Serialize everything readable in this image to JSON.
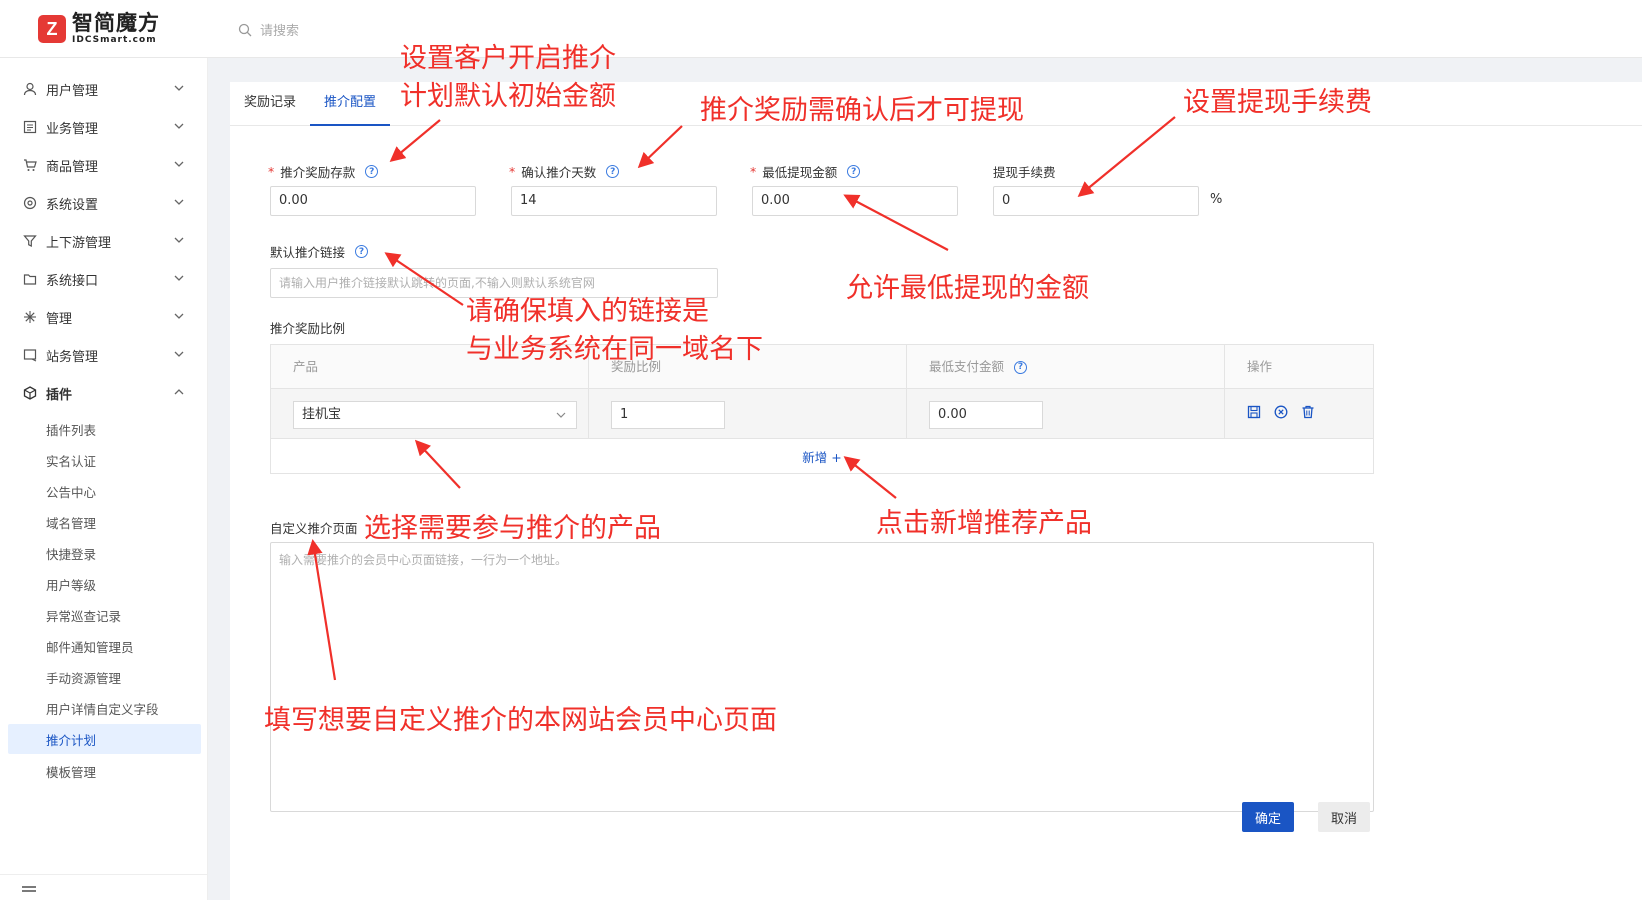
{
  "header": {
    "logo_cn": "智简魔方",
    "logo_en": "IDCSmart.com",
    "search_placeholder": "请搜索"
  },
  "sidebar": {
    "items": [
      {
        "label": "用户管理",
        "icon": "user-icon"
      },
      {
        "label": "业务管理",
        "icon": "list-icon"
      },
      {
        "label": "商品管理",
        "icon": "cart-icon"
      },
      {
        "label": "系统设置",
        "icon": "settings-icon"
      },
      {
        "label": "上下游管理",
        "icon": "filter-icon"
      },
      {
        "label": "系统接口",
        "icon": "folder-icon"
      },
      {
        "label": "管理",
        "icon": "asterisk-icon"
      },
      {
        "label": "站务管理",
        "icon": "window-icon"
      },
      {
        "label": "插件",
        "icon": "cube-icon"
      }
    ],
    "sub_items": [
      "插件列表",
      "实名认证",
      "公告中心",
      "域名管理",
      "快捷登录",
      "用户等级",
      "异常巡查记录",
      "邮件通知管理员",
      "手动资源管理",
      "用户详情自定义字段",
      "推介计划",
      "模板管理"
    ],
    "active_sub": "推介计划"
  },
  "tabs": [
    {
      "label": "奖励记录",
      "active": false
    },
    {
      "label": "推介配置",
      "active": true
    }
  ],
  "form": {
    "deposit": {
      "label": "推介奖励存款",
      "required": true,
      "value": "0.00"
    },
    "confirm_days": {
      "label": "确认推介天数",
      "required": true,
      "value": "14"
    },
    "min_withdraw": {
      "label": "最低提现金额",
      "required": true,
      "value": "0.00"
    },
    "fee": {
      "label": "提现手续费",
      "required": false,
      "value": "0",
      "unit": "%"
    },
    "default_link": {
      "label": "默认推介链接",
      "placeholder": "请输入用户推介链接默认跳转的页面,不输入则默认系统官网"
    },
    "ratio_title": "推介奖励比例",
    "table": {
      "headers": [
        "产品",
        "奖励比例",
        "最低支付金额",
        "操作"
      ],
      "row": {
        "product": "挂机宝",
        "ratio": "1",
        "min_pay": "0.00"
      },
      "add_label": "新增 +"
    },
    "custom_page": {
      "label": "自定义推介页面",
      "placeholder": "输入需要推介的会员中心页面链接，一行为一个地址。"
    },
    "confirm_label": "确定",
    "cancel_label": "取消"
  },
  "annotations": {
    "a1_line1": "设置客户开启推介",
    "a1_line2": "计划默认初始金额",
    "a2": "推介奖励需确认后才可提现",
    "a3": "设置提现手续费",
    "a4": "允许最低提现的金额",
    "a5_line1": "请确保填入的链接是",
    "a5_line2": "与业务系统在同一域名下",
    "a6": "选择需要参与推介的产品",
    "a7": "点击新增推荐产品",
    "a8": "填写想要自定义推介的本网站会员中心页面",
    "color": "#f0302a"
  },
  "colors": {
    "accent": "#1a55c4",
    "required": "#e53935"
  }
}
